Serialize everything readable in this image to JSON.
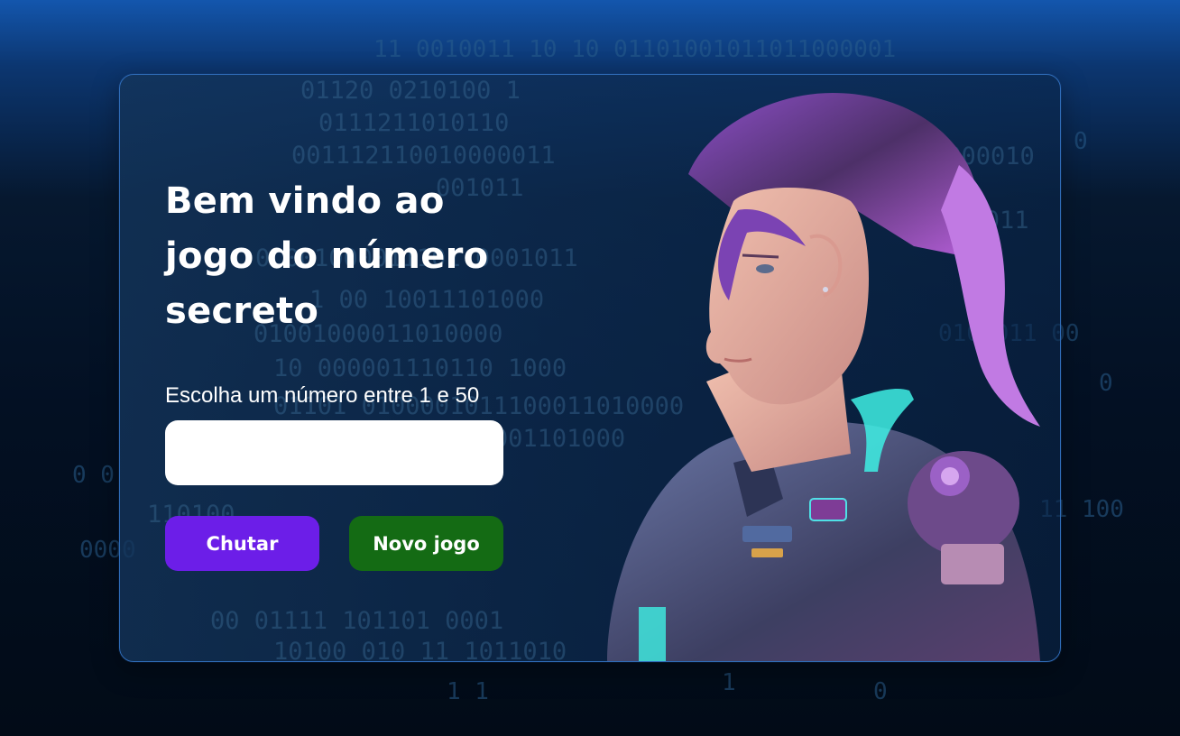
{
  "title": "Bem vindo ao jogo do número secreto",
  "instruction": "Escolha um número entre 1 e 50",
  "input": {
    "value": "",
    "placeholder": ""
  },
  "buttons": {
    "guess_label": "Chutar",
    "new_game_label": "Novo jogo"
  },
  "colors": {
    "guess": "#6c1ee8",
    "new_game": "#146b14",
    "card_border": "#2f6cb8"
  },
  "illustration": "astronaut-girl-illustration"
}
